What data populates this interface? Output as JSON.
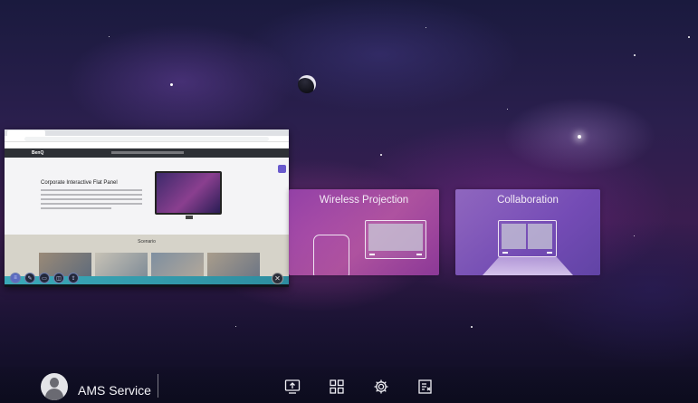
{
  "browser": {
    "logo": "BenQ",
    "heading": "Corporate Interactive Flat Panel",
    "section_title": "Scenario",
    "close_glyph": "✕"
  },
  "cards": [
    {
      "title": "Wireless Projection"
    },
    {
      "title": "Collaboration"
    }
  ],
  "user": {
    "name": "AMS Service",
    "avatar_icon": "person-icon"
  },
  "dock": {
    "icons": [
      "screen-share-icon",
      "apps-grid-icon",
      "settings-gear-icon",
      "exit-signout-icon"
    ]
  },
  "colors": {
    "wireless_card": "#b25bb0",
    "collab_card": "#8a6cc6",
    "browser_toolbar": "#3aa9b8"
  }
}
